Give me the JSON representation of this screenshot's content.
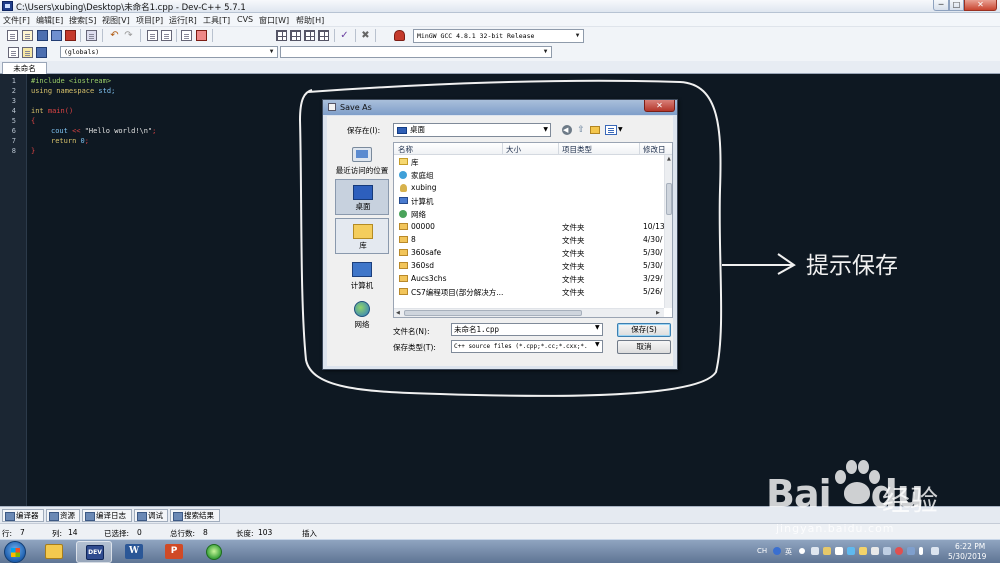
{
  "window": {
    "title": "C:\\Users\\xubing\\Desktop\\未命名1.cpp - Dev-C++ 5.7.1",
    "minimize": "─",
    "maximize": "□",
    "close": "✕"
  },
  "menu": [
    "文件[F]",
    "编辑[E]",
    "搜索[S]",
    "视图[V]",
    "项目[P]",
    "运行[R]",
    "工具[T]",
    "CVS",
    "窗口[W]",
    "帮助[H]"
  ],
  "toolbar": {
    "compiler": "MinGW GCC 4.8.1 32-bit Release",
    "scope": "(globals)",
    "icons": [
      "new-file-icon",
      "open-file-icon",
      "save-icon",
      "save-all-icon",
      "close-file-icon",
      "print-icon",
      "undo-icon",
      "redo-icon",
      "find-icon",
      "replace-icon",
      "goto-icon",
      "window-icon",
      "compile-icon",
      "run-icon",
      "compile-run-icon",
      "rebuild-icon",
      "check-icon",
      "stop-icon",
      "chart-icon",
      "debug-icon"
    ]
  },
  "editor": {
    "tab": "未命名1.cpp",
    "line_numbers": [
      "1",
      "2",
      "3",
      "4",
      "5",
      "6",
      "7",
      "8"
    ],
    "lines": {
      "l1": "#include <iostream>",
      "l2_kw": "using namespace",
      "l2_rest": " std;",
      "l4_kw": "int",
      "l4_rest": " main()",
      "l5": "{",
      "l6_a": "cout",
      "l6_op": " << ",
      "l6_str": "\"Hello world!\\n\"",
      "l6_end": ";",
      "l7_kw": "return",
      "l7_num": " 0",
      "l7_end": ";",
      "l8": "}"
    }
  },
  "dialog": {
    "title": "Save As",
    "close": "✕",
    "save_in_label": "保存在(I):",
    "save_in_value": "桌面",
    "places": [
      "最近访问的位置",
      "桌面",
      "库",
      "计算机",
      "网络"
    ],
    "columns": [
      "名称",
      "大小",
      "项目类型",
      "修改日"
    ],
    "rows": [
      {
        "name": "库",
        "type": "",
        "date": ""
      },
      {
        "name": "家庭组",
        "type": "",
        "date": ""
      },
      {
        "name": "xubing",
        "type": "",
        "date": ""
      },
      {
        "name": "计算机",
        "type": "",
        "date": ""
      },
      {
        "name": "网络",
        "type": "",
        "date": ""
      },
      {
        "name": "00000",
        "type": "文件夹",
        "date": "10/13"
      },
      {
        "name": "8",
        "type": "文件夹",
        "date": "4/30/"
      },
      {
        "name": "360safe",
        "type": "文件夹",
        "date": "5/30/"
      },
      {
        "name": "360sd",
        "type": "文件夹",
        "date": "5/30/"
      },
      {
        "name": "Aucs3chs",
        "type": "文件夹",
        "date": "3/29/"
      },
      {
        "name": "CS7编程项目(部分解决方...",
        "type": "文件夹",
        "date": "5/26/"
      }
    ],
    "filename_label": "文件名(N):",
    "filename_value": "未命名1.cpp",
    "filetype_label": "保存类型(T):",
    "filetype_value": "C++ source files (*.cpp;*.cc;*.cxx;*.",
    "save_button": "保存(S)",
    "cancel_button": "取消"
  },
  "annotation": {
    "text": "提示保存",
    "color": "#f0f0f0"
  },
  "bottom_tabs": [
    "编译器",
    "资源",
    "编译日志",
    "调试",
    "搜索结果"
  ],
  "status": {
    "row_label": "行:",
    "row": "7",
    "col_label": "列:",
    "col": "14",
    "sel_label": "已选择:",
    "sel": "0",
    "total_label": "总行数:",
    "total": "8",
    "len_label": "长度:",
    "len": "103",
    "mode": "插入"
  },
  "taskbar": {
    "apps": [
      "windows-explorer",
      "dev-cpp",
      "word",
      "powerpoint",
      "360-browser"
    ],
    "devcpp_label": "DEV",
    "word_label": "W",
    "ppt_label": "P",
    "tray_lang": "CH",
    "tray_ime": "英",
    "time": "6:22 PM",
    "date": "5/30/2019"
  },
  "watermark": {
    "brand": "Bai",
    "brand_tail": "du",
    "brand_cn": "经验",
    "url": "jingyan.baidu.com"
  },
  "colors": {
    "editor_bg": "#0e1822",
    "keyword": "#d6c06a",
    "string": "#e2e2e2",
    "operator": "#dd4444",
    "preprocessor": "#9acd68"
  }
}
